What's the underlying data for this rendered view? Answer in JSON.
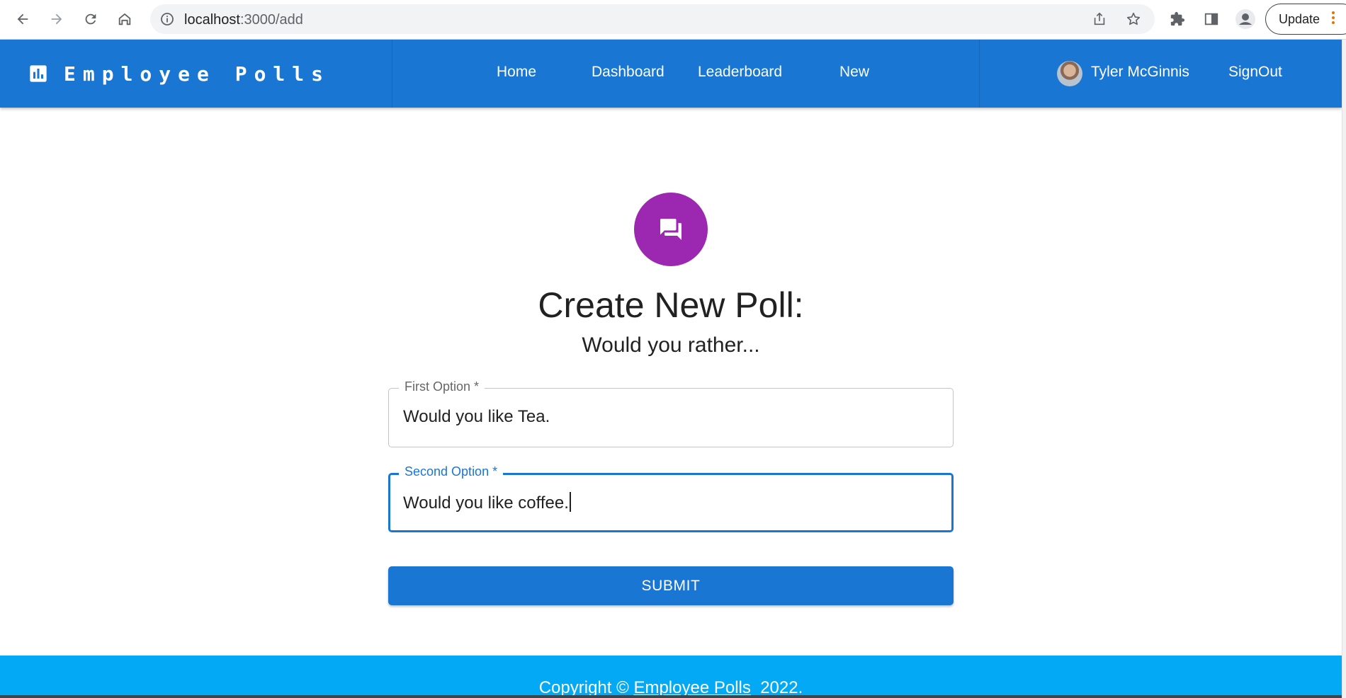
{
  "browser": {
    "url_host": "localhost",
    "url_path": ":3000/add",
    "update_label": "Update"
  },
  "appbar": {
    "title": "Employee Polls",
    "nav": [
      "Home",
      "Dashboard",
      "Leaderboard",
      "New"
    ],
    "user_name": "Tyler McGinnis",
    "signout_label": "SignOut"
  },
  "form": {
    "title": "Create New Poll:",
    "subtitle": "Would you rather...",
    "first_option_label": "First Option *",
    "first_option_value": "Would you like Tea.",
    "second_option_label": "Second Option *",
    "second_option_value": "Would you like coffee.",
    "submit_label": "SUBMIT"
  },
  "footer": {
    "prefix": "Copyright © ",
    "link": "Employee Polls",
    "suffix": "  2022."
  },
  "colors": {
    "appbar": "#1976d2",
    "avatar": "#9c27b0",
    "footer": "#03a9f4",
    "focus": "#1976d2"
  }
}
